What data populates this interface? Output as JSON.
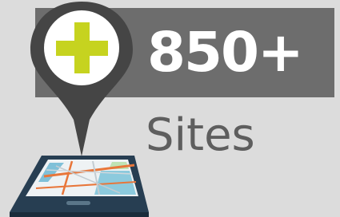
{
  "badge": {
    "count": "850+",
    "label": "Sites"
  },
  "icons": {
    "pin": "map-pin-icon",
    "plus": "plus-icon",
    "phone": "smartphone-icon",
    "map": "map-icon"
  },
  "colors": {
    "background": "#dcdcdc",
    "banner": "#6d6d6d",
    "count_text": "#ffffff",
    "label_text": "#5e5e5e",
    "pin": "#454545",
    "plus": "#c6d31f",
    "phone_body": "#273e52",
    "map_route": "#e8763a"
  }
}
